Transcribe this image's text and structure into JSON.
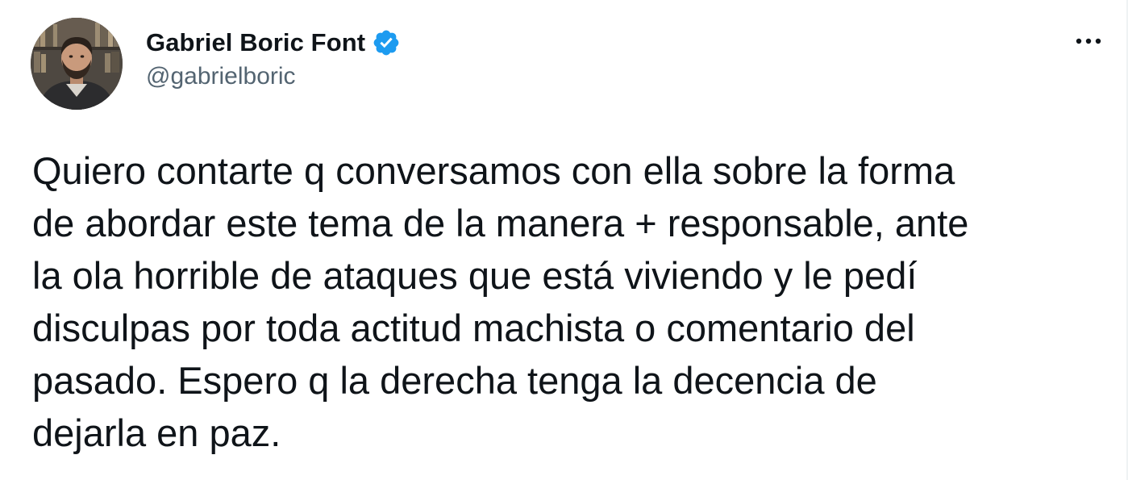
{
  "tweet": {
    "author": {
      "display_name": "Gabriel Boric Font",
      "handle": "@gabrielboric",
      "verified": true,
      "avatar_icon": "profile-photo"
    },
    "more_icon": "more-options-icon",
    "text": "Quiero contarte q conversamos con ella sobre la forma\nde abordar este tema de la manera + responsable, ante\nla ola horrible de ataques que está viviendo y le pedí\ndisculpas por toda actitud machista o comentario del\npasado. Espero q la derecha tenga la decencia de\ndejarla en paz."
  },
  "colors": {
    "text_primary": "#0f1419",
    "text_secondary": "#536471",
    "verified_blue": "#1d9bf0",
    "background": "#ffffff"
  }
}
